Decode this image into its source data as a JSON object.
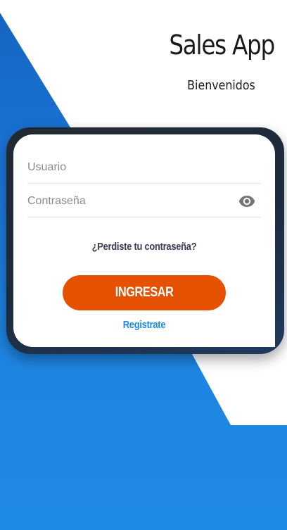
{
  "header": {
    "app_title": "Sales App",
    "subtitle": "Bienvenidos"
  },
  "form": {
    "username_placeholder": "Usuario",
    "username_value": "",
    "password_placeholder": "Contraseña",
    "password_value": "",
    "toggle_visibility_icon": "eye-icon",
    "forgot_password_label": "¿Perdiste tu contraseña?",
    "login_button_label": "INGRESAR",
    "register_label": "Registrate"
  },
  "colors": {
    "primary_blue": "#1e88e5",
    "accent_orange": "#e55100",
    "card_frame": "#1f2a38",
    "text_dark": "#1a1a1a",
    "link_dark": "#363b5a"
  }
}
